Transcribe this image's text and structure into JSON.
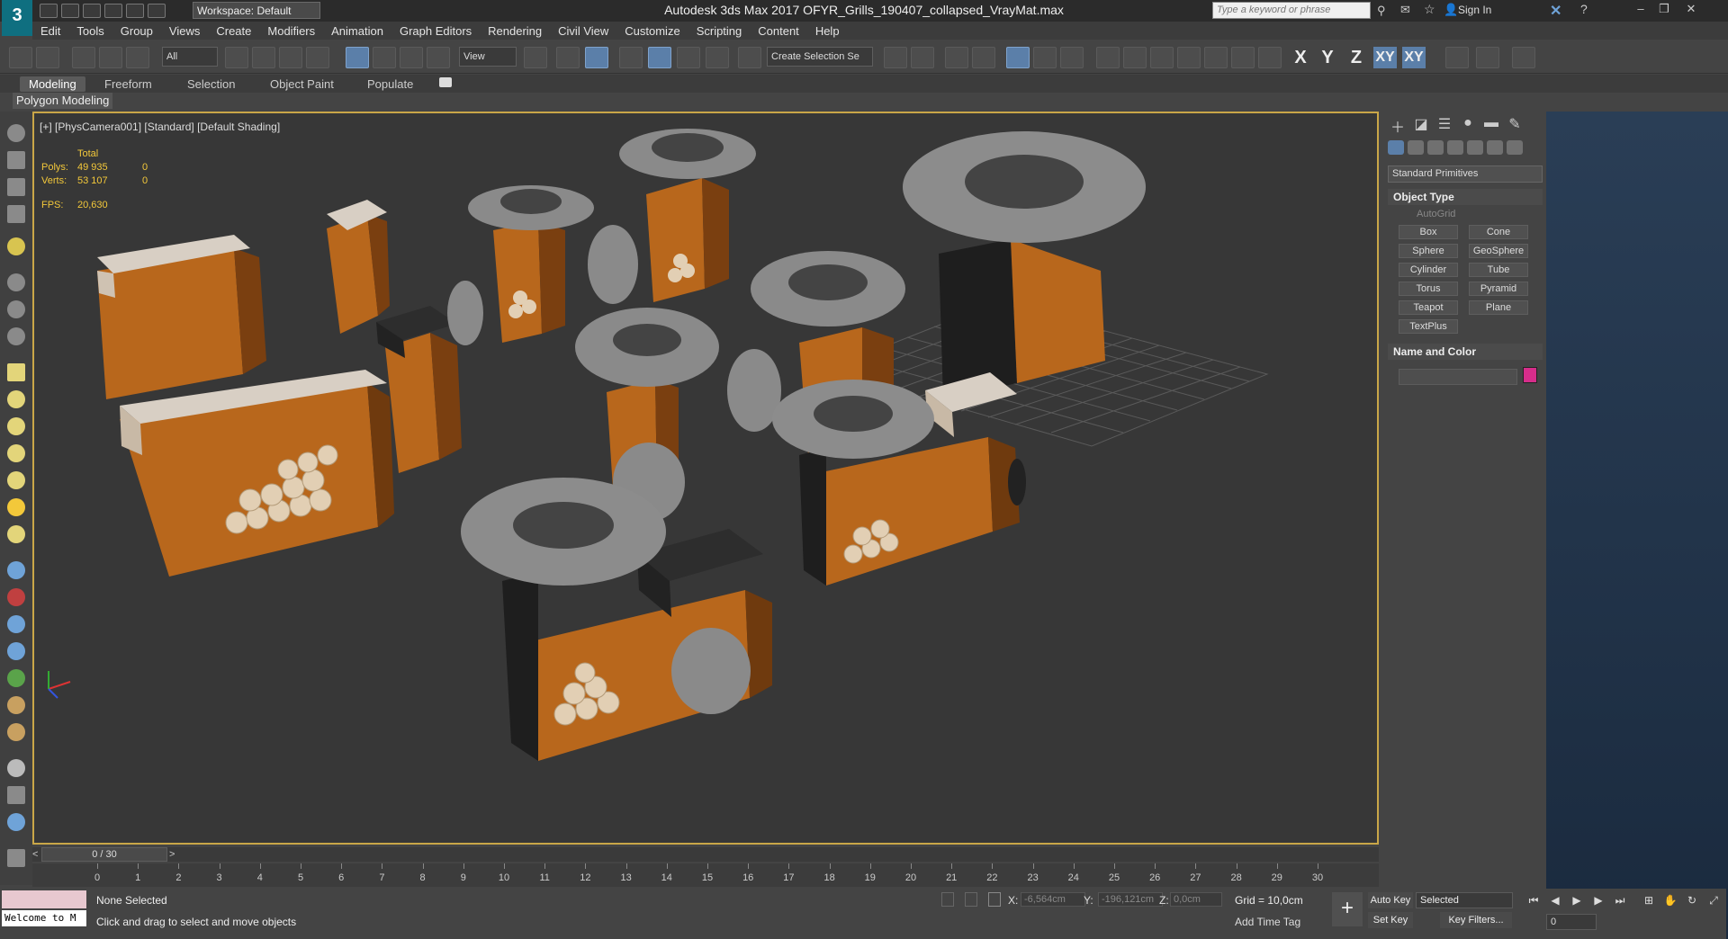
{
  "app": {
    "logo": "3",
    "window_title": "Autodesk 3ds Max 2017     OFYR_Grills_190407_collapsed_VrayMat.max",
    "workspace": "Workspace: Default",
    "search_placeholder": "Type a keyword or phrase",
    "sign_in": "Sign In"
  },
  "menu": [
    "Edit",
    "Tools",
    "Group",
    "Views",
    "Create",
    "Modifiers",
    "Animation",
    "Graph Editors",
    "Rendering",
    "Civil View",
    "Customize",
    "Scripting",
    "Content",
    "Help"
  ],
  "toolbar": {
    "selection_filter": "All",
    "ref_coord": "View",
    "named_selection": "Create Selection Se",
    "axes": [
      "X",
      "Y",
      "Z",
      "XY",
      "XY"
    ]
  },
  "ribbon": {
    "tabs": [
      "Modeling",
      "Freeform",
      "Selection",
      "Object Paint",
      "Populate"
    ],
    "active_tab": "Modeling",
    "sub_panel": "Polygon Modeling"
  },
  "viewport": {
    "label": "[+] [PhysCamera001] [Standard] [Default Shading]",
    "stats": {
      "total_label": "Total",
      "polys_label": "Polys:",
      "polys_total": "49 935",
      "polys_sel": "0",
      "verts_label": "Verts:",
      "verts_total": "53 107",
      "verts_sel": "0",
      "fps_label": "FPS:",
      "fps": "20,630"
    }
  },
  "command_panel": {
    "category": "Standard Primitives",
    "object_type_title": "Object Type",
    "autogrid": "AutoGrid",
    "primitives": [
      "Box",
      "Cone",
      "Sphere",
      "GeoSphere",
      "Cylinder",
      "Tube",
      "Torus",
      "Pyramid",
      "Teapot",
      "Plane",
      "TextPlus"
    ],
    "name_color_title": "Name and Color",
    "swatch_color": "#d62d8a"
  },
  "timeline": {
    "slider": "0 / 30",
    "ticks": [
      "0",
      "1",
      "2",
      "3",
      "4",
      "5",
      "6",
      "7",
      "8",
      "9",
      "10",
      "11",
      "12",
      "13",
      "14",
      "15",
      "16",
      "17",
      "18",
      "19",
      "20",
      "21",
      "22",
      "23",
      "24",
      "25",
      "26",
      "27",
      "28",
      "29",
      "30"
    ]
  },
  "status": {
    "maxscript": "Welcome to M",
    "selection": "None Selected",
    "prompt": "Click and drag to select and move objects",
    "x_label": "X:",
    "x_val": "-6,564cm",
    "y_label": "Y:",
    "y_val": "-196,121cm",
    "z_label": "Z:",
    "z_val": "0,0cm",
    "grid": "Grid = 10,0cm",
    "add_time_tag": "Add Time Tag",
    "auto_key": "Auto Key",
    "set_key": "Set Key",
    "selected_dd": "Selected",
    "key_filters": "Key Filters...",
    "frame": "0"
  },
  "colors": {
    "viewport_bg": "#373737",
    "viewport_border": "#c9a648",
    "corten": "#b5651d",
    "grill_top": "#8a8a8a",
    "stats_text": "#f3c83a"
  }
}
